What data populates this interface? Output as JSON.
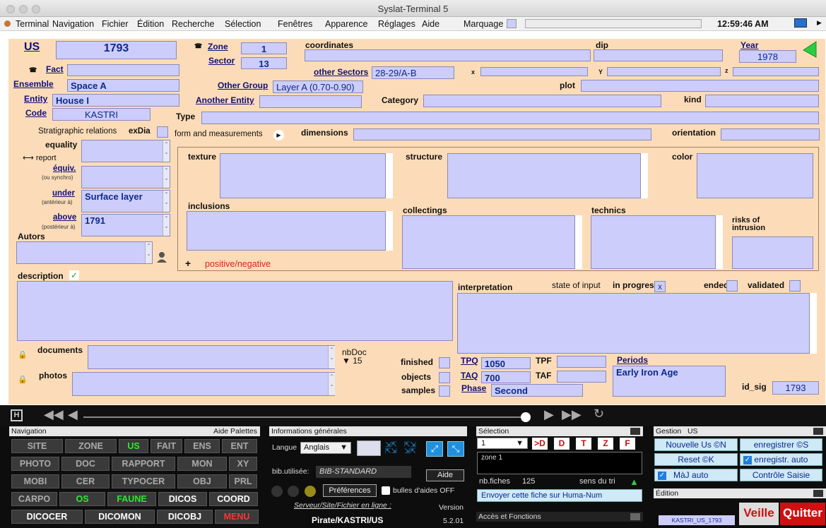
{
  "window": {
    "title": "Syslat-Terminal 5"
  },
  "menu": {
    "items": [
      "Terminal",
      "Navigation",
      "Fichier",
      "Édition",
      "Recherche",
      "Sélection",
      "Fenêtres",
      "Apparence",
      "Réglages",
      "Aide"
    ],
    "marquage": "Marquage",
    "clock": "12:59:46 AM"
  },
  "form": {
    "us_label": "US",
    "us_value": "1793",
    "zone_label": "Zone",
    "zone_value": "1",
    "sector_label": "Sector",
    "sector_value": "13",
    "coordinates_label": "coordinates",
    "dip_label": "dip",
    "year_label": "Year",
    "year_value": "1978",
    "fact_label": "Fact",
    "other_sectors_label": "other Sectors",
    "other_sectors_value": "28-29/A-B",
    "x_label": "x",
    "y_label": "Y",
    "z_label": "z",
    "ensemble_label": "Ensemble",
    "ensemble_value": "Space A",
    "other_group_label": "Other Group",
    "other_group_value": "Layer A (0.70-0.90)",
    "plot_label": "plot",
    "entity_label": "Entity",
    "entity_value": "House I",
    "another_entity_label": "Another Entity",
    "category_label": "Category",
    "kind_label": "kind",
    "code_label": "Code",
    "code_value": "KASTRI",
    "type_label": "Type",
    "strat_label": "Stratigraphic relations",
    "exdia_label": "exDia",
    "form_meas_label": "form and measurements",
    "dimensions_label": "dimensions",
    "orientation_label": "orientation",
    "equality_label": "equality",
    "report_label": "report",
    "equiv_label": "équiv.",
    "equiv_sub": "(ou synchro)",
    "under_label": "under",
    "under_sub": "(antérieur à)",
    "under_value": "Surface layer",
    "above_label": "above",
    "above_sub": "(postérieur à)",
    "above_value": "1791",
    "autors_label": "Autors",
    "texture_label": "texture",
    "structure_label": "structure",
    "color_label": "color",
    "inclusions_label": "inclusions",
    "collectings_label": "collectings",
    "technics_label": "technics",
    "risks_label": "risks of intrusion",
    "plus": "+",
    "posneg_label": "positive/negative",
    "description_label": "description",
    "description_check": "✓",
    "interpretation_label": "interpretation",
    "state_label": "state of input",
    "in_progress_label": "in progress",
    "in_progress_value": "x",
    "ended_label": "ended",
    "validated_label": "validated",
    "documents_label": "documents",
    "photos_label": "photos",
    "nbdoc_label": "nbDoc",
    "nbdoc_value": "15",
    "finished_label": "finished",
    "objects_label": "objects",
    "samples_label": "samples",
    "tpq_label": "TPQ",
    "tpq_value": "1050",
    "tpf_label": "TPF",
    "taq_label": "TAQ",
    "taq_value": "700",
    "taf_label": "TAF",
    "phase_label": "Phase",
    "phase_value": "Second",
    "periods_label": "Periods",
    "periods_value": "Early Iron Age",
    "idsig_label": "id_sig",
    "idsig_value": "1793"
  },
  "navigation": {
    "title": "Navigation",
    "aide": "Aide Palettes",
    "rows": [
      [
        "SITE",
        "ZONE",
        "US",
        "FAIT",
        "ENS",
        "ENT"
      ],
      [
        "PHOTO",
        "DOC",
        "RAPPORT",
        "MON",
        "XY"
      ],
      [
        "MOBI",
        "CER",
        "TYPOCER",
        "OBJ",
        "PRL"
      ],
      [
        "CARPO",
        "OS",
        "FAUNE",
        "DICOS",
        "COORD"
      ],
      [
        "DICOCER",
        "DICOMON",
        "DICOBJ",
        "MENU"
      ]
    ]
  },
  "info": {
    "title": "Informations générales",
    "langue_label": "Langue",
    "langue_value": "Anglais",
    "bib_label": "bib.utilisée:",
    "bib_value": "BIB-STANDARD",
    "aide_button": "Aide",
    "pref_button": "Préférences",
    "bulles_label": "bulles d'aides OFF",
    "serveur_label": "Serveur/Site/Fichier en ligne :",
    "version_label": "Version",
    "server_value": "Pirate/KASTRI/US",
    "version_value": "5.2.01"
  },
  "selection": {
    "title": "Sélection",
    "number": "1",
    "letters": [
      ">D",
      "D",
      "T",
      "Z",
      "F"
    ],
    "zone_text": "zone 1",
    "nbfiches_label": "nb.fiches",
    "nbfiches_value": "125",
    "sens_label": "sens du tri",
    "humanum_button": "Envoyer cette fiche sur Huma-Num",
    "acces_label": "Accès et Fonctions"
  },
  "gestion": {
    "title": "Gestion",
    "title2": "US",
    "nouvelle": "Nouvelle Us ©N",
    "enregistrer": "enregistrer ©S",
    "reset": "Reset ©K",
    "enreg_auto": "enregistr. auto",
    "maj_auto": "MàJ auto",
    "controle": "Contrôle Saisie",
    "edition_label": "Édition",
    "record_tag": "KASTRI_US_1793",
    "veille": "Veille",
    "quitter": "Quitter"
  }
}
